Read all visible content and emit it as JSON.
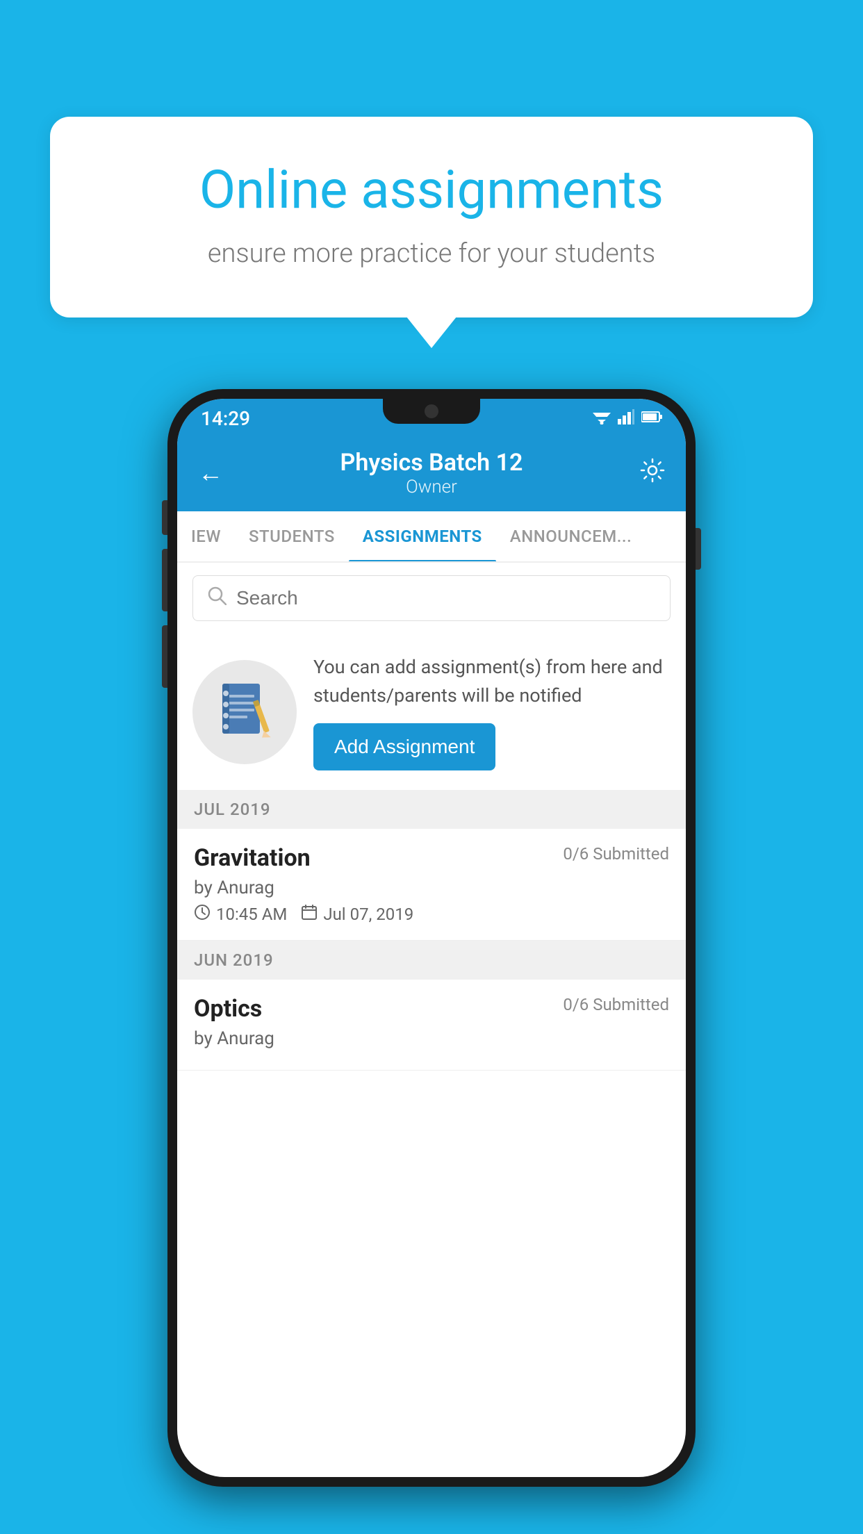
{
  "background_color": "#1ab4e8",
  "speech_bubble": {
    "title": "Online assignments",
    "subtitle": "ensure more practice for your students"
  },
  "phone": {
    "status_bar": {
      "time": "14:29",
      "wifi": "▼▲",
      "signal": "◀",
      "battery": "▮"
    },
    "header": {
      "title": "Physics Batch 12",
      "subtitle": "Owner",
      "back_label": "←",
      "settings_label": "⚙"
    },
    "tabs": [
      {
        "label": "IEW",
        "active": false
      },
      {
        "label": "STUDENTS",
        "active": false
      },
      {
        "label": "ASSIGNMENTS",
        "active": true
      },
      {
        "label": "ANNOUNCEM...",
        "active": false
      }
    ],
    "search": {
      "placeholder": "Search"
    },
    "info_card": {
      "description": "You can add assignment(s) from here and students/parents will be notified",
      "button_label": "Add Assignment"
    },
    "assignments": [
      {
        "month_label": "JUL 2019",
        "items": [
          {
            "title": "Gravitation",
            "submitted": "0/6 Submitted",
            "author": "by Anurag",
            "time": "10:45 AM",
            "date": "Jul 07, 2019"
          }
        ]
      },
      {
        "month_label": "JUN 2019",
        "items": [
          {
            "title": "Optics",
            "submitted": "0/6 Submitted",
            "author": "by Anurag",
            "time": "",
            "date": ""
          }
        ]
      }
    ]
  }
}
